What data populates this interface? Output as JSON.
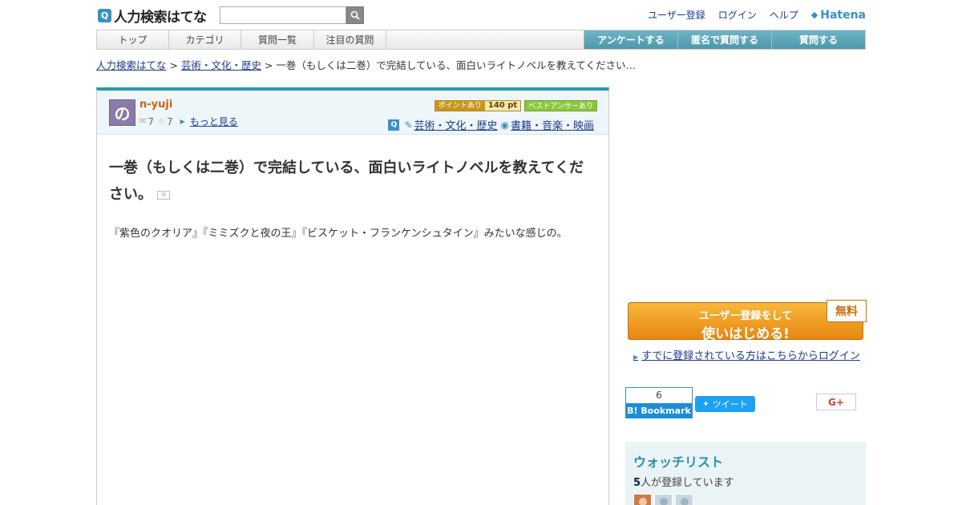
{
  "header": {
    "logo_q": "Q",
    "logo_text": "人力検索はてな",
    "search_placeholder": "",
    "links": [
      "ユーザー登録",
      "ログイン",
      "ヘルプ"
    ],
    "hatena_logo": "Hatena"
  },
  "nav": {
    "tabs": [
      "トップ",
      "カテゴリ",
      "質問一覧",
      "注目の質問"
    ],
    "actions": [
      "アンケートする",
      "匿名で質問する",
      "質問する"
    ]
  },
  "breadcrumb": {
    "home": "人力検索はてな",
    "sep": " > ",
    "category": "芸術・文化・歴史",
    "current": "一巻（もしくは二巻）で完結している、面白いライトノベルを教えてください…"
  },
  "question": {
    "avatar_char": "の",
    "username": "n-yuji",
    "stat1": "7",
    "stat2": "7",
    "more": "もっと見る",
    "point_label": "ポイントあり",
    "points": "140",
    "points_unit": "pt",
    "best_answer": "ベストアンサーあり",
    "cat_q": "Q",
    "categories": [
      "芸術・文化・歴史",
      "書籍・音楽・映画"
    ],
    "title": "一巻（もしくは二巻）で完結している、面白いライトノベルを教えてください。",
    "body": "『紫色のクオリア』『ミミズクと夜の王』『ビスケット・フランケンシュタイン』みたいな感じの。"
  },
  "sidebar": {
    "signup_line1": "ユーザー登録をして",
    "signup_line2": "使いはじめる!",
    "free_tag": "無料",
    "login_text": "すでに登録されている方はこちらからログイン",
    "bookmark_count": "6",
    "bookmark_label": "B! Bookmark",
    "tweet_label": "ツイート",
    "gplus_label": "G+",
    "watch_title": "ウォッチリスト",
    "watch_count": "5",
    "watch_suffix": "人が登録しています"
  },
  "colors": {
    "accent": "#2a9aa9",
    "link": "#1a3b8b",
    "signup": "#e78712",
    "username": "#c06a10"
  },
  "icons": [
    "search-icon",
    "hatena-bird-icon",
    "answer-icon",
    "star-icon",
    "arrow-right-icon",
    "category-brush-icon",
    "category-globe-icon",
    "twitter-bird-icon",
    "memo-icon"
  ]
}
